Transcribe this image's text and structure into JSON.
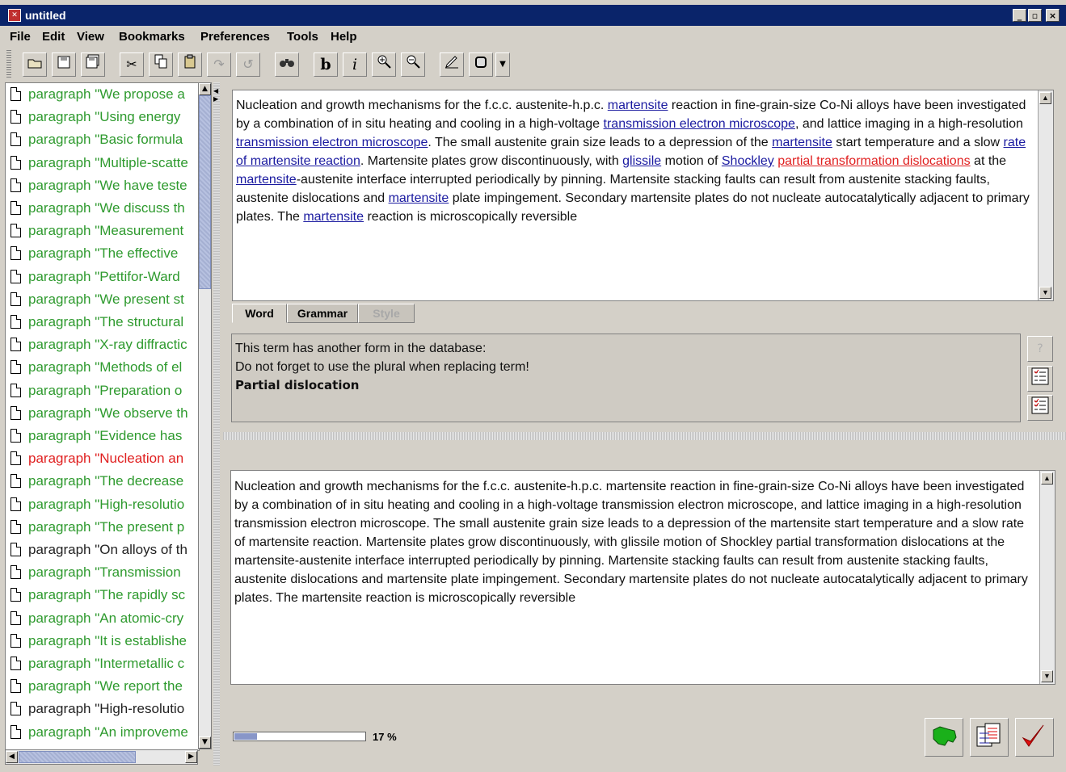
{
  "window": {
    "title": "untitled",
    "controls": [
      "_",
      "▫",
      "×"
    ]
  },
  "menu": [
    "File",
    "Edit",
    "View",
    "Bookmarks",
    "Preferences",
    "Tools",
    "Help"
  ],
  "toolbar": {
    "bold": "b",
    "italic": "i",
    "buttons": [
      "open-icon",
      "save-icon",
      "save-as-icon",
      "cut-icon",
      "copy-icon",
      "paste-icon",
      "undo-icon",
      "redo-icon",
      "find-icon",
      "bold-icon",
      "italic-icon",
      "zoom-in-icon",
      "zoom-out-icon",
      "edit-tool-icon",
      "stop-icon",
      "dropdown-icon"
    ]
  },
  "paragraph_list": [
    {
      "text": "paragraph \"We propose a",
      "color": "green"
    },
    {
      "text": "paragraph \"Using energy",
      "color": "green"
    },
    {
      "text": "paragraph \"Basic formula",
      "color": "green"
    },
    {
      "text": "paragraph \"Multiple-scatte",
      "color": "green"
    },
    {
      "text": "paragraph \"We have teste",
      "color": "green"
    },
    {
      "text": "paragraph \"We discuss th",
      "color": "green"
    },
    {
      "text": "paragraph \"Measurement",
      "color": "green"
    },
    {
      "text": "paragraph \"The effective",
      "color": "green"
    },
    {
      "text": "paragraph \"Pettifor-Ward",
      "color": "green"
    },
    {
      "text": "paragraph \"We present st",
      "color": "green"
    },
    {
      "text": "paragraph \"The structural",
      "color": "green"
    },
    {
      "text": "paragraph \"X-ray diffractic",
      "color": "green"
    },
    {
      "text": "paragraph \"Methods of el",
      "color": "green"
    },
    {
      "text": "paragraph \"Preparation o",
      "color": "green"
    },
    {
      "text": "paragraph \"We observe th",
      "color": "green"
    },
    {
      "text": "paragraph \"Evidence has",
      "color": "green"
    },
    {
      "text": "paragraph \"Nucleation an",
      "color": "red"
    },
    {
      "text": "paragraph \"The decrease",
      "color": "green"
    },
    {
      "text": "paragraph \"High-resolutio",
      "color": "green"
    },
    {
      "text": "paragraph \"The present p",
      "color": "green"
    },
    {
      "text": "paragraph \"On alloys of th",
      "color": "black"
    },
    {
      "text": "paragraph \"Transmission",
      "color": "green"
    },
    {
      "text": "paragraph \"The rapidly sc",
      "color": "green"
    },
    {
      "text": "paragraph \"An atomic-cry",
      "color": "green"
    },
    {
      "text": "paragraph \"It is establishe",
      "color": "green"
    },
    {
      "text": "paragraph \"Intermetallic c",
      "color": "green"
    },
    {
      "text": "paragraph \"We report the",
      "color": "green"
    },
    {
      "text": "paragraph \"High-resolutio",
      "color": "black"
    },
    {
      "text": "paragraph \"An improveme",
      "color": "green"
    }
  ],
  "top_text": [
    {
      "t": "Nucleation and growth mechanisms for the f.c.c. austenite-h.p.c. "
    },
    {
      "t": "martensite",
      "link": "blue"
    },
    {
      "t": " reaction in fine-grain-size Co-Ni alloys have been investigated by a combination of in situ heating and cooling in a high-voltage "
    },
    {
      "t": "transmission electron microscope",
      "link": "blue"
    },
    {
      "t": ", and lattice imaging in a high-resolution "
    },
    {
      "t": "transmission electron microscope",
      "link": "blue"
    },
    {
      "t": ". The small austenite grain size leads to a depression of the "
    },
    {
      "t": "martensite",
      "link": "blue"
    },
    {
      "t": " start temperature and a slow "
    },
    {
      "t": "rate of martensite reaction",
      "link": "blue"
    },
    {
      "t": ". Martensite plates grow discontinuously, with "
    },
    {
      "t": "glissile",
      "link": "blue"
    },
    {
      "t": " motion of "
    },
    {
      "t": "Shockley",
      "link": "blue"
    },
    {
      "t": " "
    },
    {
      "t": "partial transformation dislocations",
      "link": "red"
    },
    {
      "t": " at the "
    },
    {
      "t": "martensite",
      "link": "blue"
    },
    {
      "t": "-austenite interface interrupted periodically by pinning. Martensite stacking faults can result from austenite stacking faults, austenite dislocations and "
    },
    {
      "t": "martensite",
      "link": "blue"
    },
    {
      "t": " plate impingement. Secondary martensite plates do not nucleate autocatalytically adjacent to primary plates. The "
    },
    {
      "t": "martensite",
      "link": "blue"
    },
    {
      "t": " reaction is microscopically reversible"
    }
  ],
  "tabs": [
    "Word",
    "Grammar",
    "Style"
  ],
  "message": {
    "line1": "This term has another form in the database:",
    "line2": "Do not forget to use the plural when replacing term!",
    "line3": "Partial dislocation"
  },
  "bottom_text": "Nucleation and growth mechanisms for the f.c.c. austenite-h.p.c. martensite reaction in fine-grain-size Co-Ni alloys have been investigated by a combination of in situ heating and cooling in a high-voltage transmission electron microscope, and lattice imaging in a high-resolution transmission electron microscope. The small austenite grain size leads to a depression of the martensite start temperature and a slow rate of martensite reaction. Martensite plates grow discontinuously, with glissile motion of Shockley partial transformation dislocations at the martensite-austenite interface interrupted periodically by pinning. Martensite stacking faults can result from austenite stacking faults, austenite dislocations and martensite plate impingement. Secondary martensite plates do not nucleate autocatalytically adjacent to primary plates. The martensite reaction is microscopically reversible",
  "progress": {
    "value": 0.17,
    "label": "17 %"
  },
  "colors": {
    "titlebar": "#0a246a",
    "green": "#2e9a2e",
    "red": "#e02020",
    "link": "#1a1aa0"
  }
}
